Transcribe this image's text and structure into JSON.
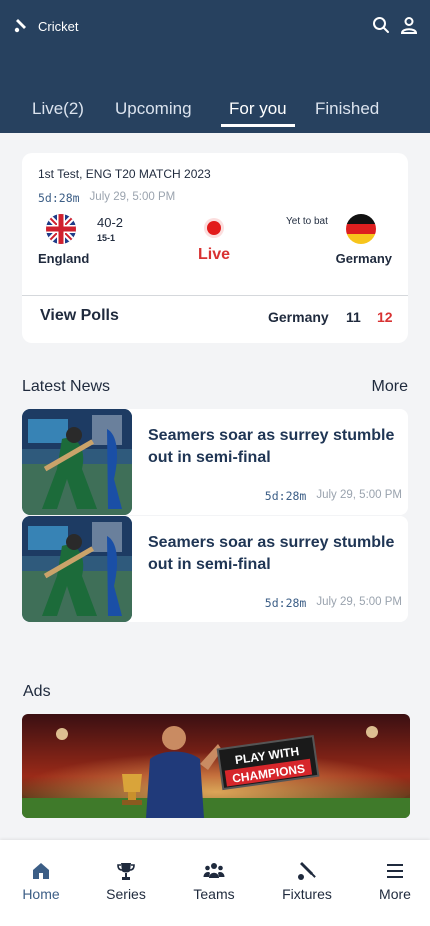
{
  "app": {
    "title": "Cricket"
  },
  "header": {
    "icons": [
      "bat-ball-icon",
      "search-icon",
      "user-icon"
    ],
    "tabs": [
      {
        "label": "Live(2)",
        "active": false
      },
      {
        "label": "Upcoming",
        "active": false
      },
      {
        "label": "For you",
        "active": true
      },
      {
        "label": "Finished",
        "active": false
      }
    ]
  },
  "match": {
    "title": "1st Test,  ENG T20 MATCH 2023",
    "countdown": "5d:28m",
    "datetime": "July 29, 5:00 PM",
    "team_left": {
      "name": "England",
      "score": "40-2",
      "overs": "15-1",
      "flag": "uk-flag-icon"
    },
    "team_right": {
      "name": "Germany",
      "status": "Yet to bat",
      "flag": "germany-flag-icon"
    },
    "live_label": "Live",
    "polls": {
      "label": "View Polls",
      "team": "Germany",
      "value_a": "11",
      "value_b": "12"
    }
  },
  "news": {
    "section_title": "Latest News",
    "more_label": "More",
    "items": [
      {
        "title": "Seamers soar as surrey stumble out in semi-final",
        "countdown": "5d:28m",
        "datetime": "July 29, 5:00 PM"
      },
      {
        "title": "Seamers soar as surrey stumble out in semi-final",
        "countdown": "5d:28m",
        "datetime": "July 29, 5:00 PM"
      }
    ]
  },
  "ads": {
    "section_title": "Ads",
    "banner_text_line1": "PLAY WITH",
    "banner_text_line2": "CHAMPIONS"
  },
  "bottom_nav": [
    {
      "label": "Home",
      "icon": "home-icon",
      "active": true
    },
    {
      "label": "Series",
      "icon": "trophy-icon",
      "active": false
    },
    {
      "label": "Teams",
      "icon": "teams-icon",
      "active": false
    },
    {
      "label": "Fixtures",
      "icon": "bat-ball-icon",
      "active": false
    },
    {
      "label": "More",
      "icon": "menu-icon",
      "active": false
    }
  ],
  "colors": {
    "header": "#27415f",
    "accent": "#3c5e86",
    "live": "#e21b1b",
    "text": "#1f2a3d"
  }
}
